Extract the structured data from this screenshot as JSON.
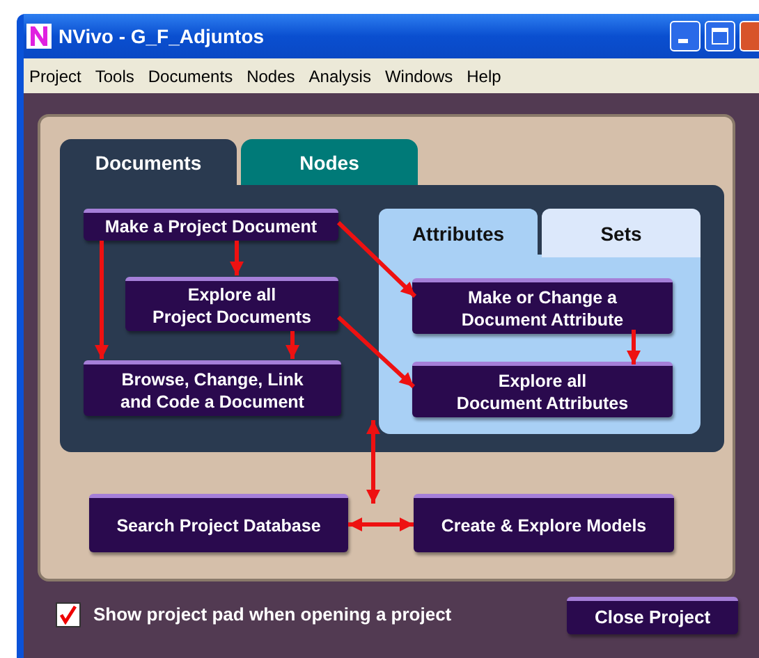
{
  "window": {
    "title": "NVivo - G_F_Adjuntos"
  },
  "menu": [
    "Project",
    "Tools",
    "Documents",
    "Nodes",
    "Analysis",
    "Windows",
    "Help"
  ],
  "tabs": [
    {
      "label": "Documents",
      "selected": true
    },
    {
      "label": "Nodes",
      "selected": false
    }
  ],
  "subtabs": [
    {
      "label": "Attributes",
      "selected": true
    },
    {
      "label": "Sets",
      "selected": false
    }
  ],
  "document_actions": [
    "Make a Project Document",
    "Explore all\nProject Documents",
    "Browse, Change, Link\nand Code a Document"
  ],
  "attribute_actions": [
    "Make or Change a\nDocument Attribute",
    "Explore all\nDocument Attributes"
  ],
  "project_actions": [
    "Search Project Database",
    "Create & Explore Models"
  ],
  "checkbox": {
    "label": "Show project pad when opening a project",
    "checked": true
  },
  "close_button": "Close Project"
}
